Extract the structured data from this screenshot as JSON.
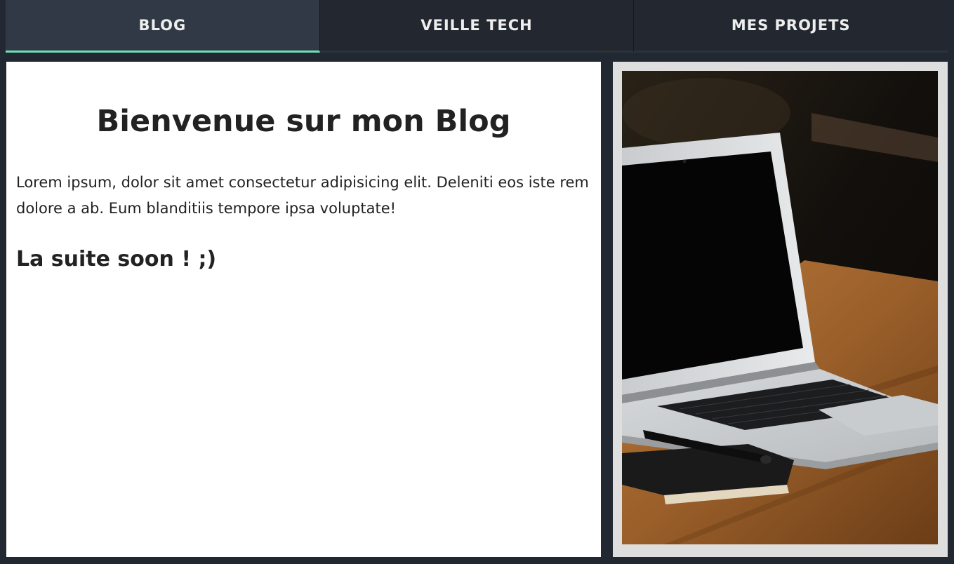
{
  "nav": {
    "tabs": [
      {
        "label": "BLOG",
        "active": true
      },
      {
        "label": "VEILLE TECH",
        "active": false
      },
      {
        "label": "MES PROJETS",
        "active": false
      }
    ],
    "accent_color": "#6fe0b8"
  },
  "article": {
    "title": "Bienvenue sur mon Blog",
    "body": "Lorem ipsum, dolor sit amet consectetur adipisicing elit. Deleniti eos iste rem dolore a ab. Eum blanditiis tempore ipsa voluptate!",
    "subtitle": "La suite soon ! ;)"
  },
  "photo": {
    "subject": "laptop-on-wooden-table-with-notebook-and-pen"
  }
}
